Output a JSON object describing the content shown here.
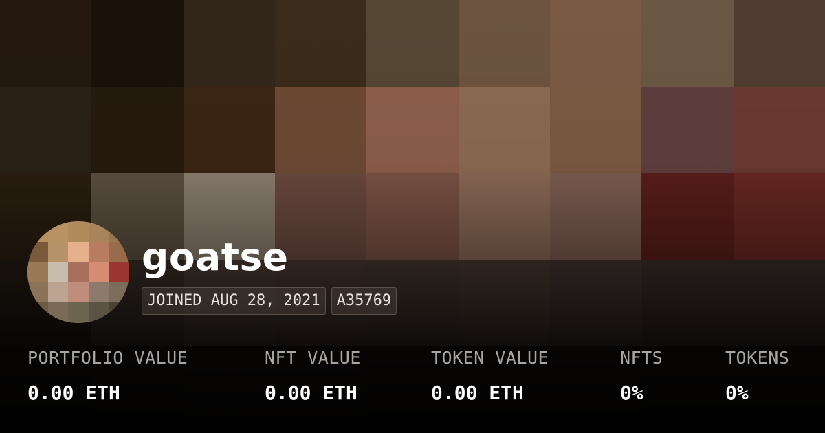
{
  "background": {
    "image": "pixelated-profile-banner",
    "tiles": [
      "#25190f",
      "#1a1108",
      "#33261a",
      "#3a2b1a",
      "#564634",
      "#6c5440",
      "#7a5a44",
      "#6a5844",
      "#503c30",
      "#2a2116",
      "#261a0e",
      "#3c2614",
      "#6e4a34",
      "#8c5e4c",
      "#8c6a52",
      "#7c5a42",
      "#5e3e3c",
      "#6a3a30",
      "#2a1e10",
      "#5c5040",
      "#8c8070",
      "#6c4a40",
      "#7c5244",
      "#8c6a56",
      "#7e5e52",
      "#5a1e1a",
      "#6a2822",
      "#241c14",
      "#3a3028",
      "#4a3c34",
      "#4a3832",
      "#463830",
      "#4a3a32",
      "#443632",
      "#3c2e2a",
      "#3c2e2a",
      "#1a1410",
      "#1c1612",
      "#1e1814",
      "#1e1814",
      "#1c1612",
      "#1c1612",
      "#1c1612",
      "#1a1410",
      "#1a1410"
    ]
  },
  "profile": {
    "username": "goatse",
    "avatar": {
      "image": "pixelated-avatar",
      "tiles": [
        "#b8905c",
        "#b89262",
        "#b08c5c",
        "#a8845a",
        "#9a7650",
        "#7a5a3a",
        "#b8936a",
        "#e6b08c",
        "#b87c60",
        "#9a6a4c",
        "#9a7a56",
        "#c8bcae",
        "#a8705a",
        "#d48c72",
        "#9a3630",
        "#8c7258",
        "#bca492",
        "#c08c7c",
        "#8c7a6c",
        "#7c6c5c",
        "#6a5a44",
        "#7c6a58",
        "#6c6650",
        "#5c5442",
        "#4a4234"
      ]
    },
    "joined": "JOINED AUG 28, 2021",
    "account_id": "A35769"
  },
  "stats": {
    "portfolio": {
      "label": "PORTFOLIO VALUE",
      "value": "0.00 ETH"
    },
    "nft_value": {
      "label": "NFT VALUE",
      "value": "0.00 ETH"
    },
    "token_value": {
      "label": "TOKEN VALUE",
      "value": "0.00 ETH"
    },
    "nfts": {
      "label": "NFTS",
      "value": "0%"
    },
    "tokens": {
      "label": "TOKENS",
      "value": "0%"
    }
  }
}
